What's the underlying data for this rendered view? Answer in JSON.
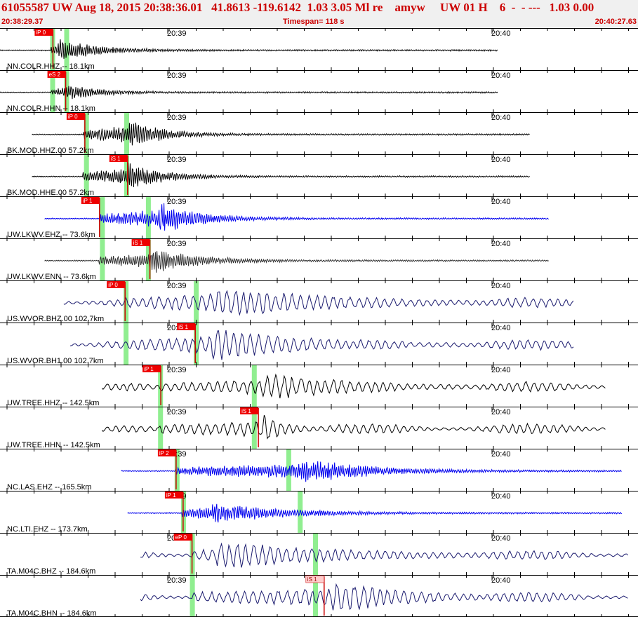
{
  "header": {
    "title": "61055587 UW Aug 18, 2015 20:38:36.01   41.8613 -119.6142  1.03 3.05 Ml re    amyw     UW 01 H    6  -  - ---   1.03 0.00",
    "time_start": "20:38:29.37",
    "timespan": "Timespan= 118 s",
    "time_end": "20:40:27.63"
  },
  "time_ticks": [
    "20:39",
    "20:40"
  ],
  "colors": {
    "trace_black": "#000000",
    "trace_blue": "#0000ee",
    "trace_gray": "#333333",
    "trace_navy": "#1a1a6e",
    "pick_flag": "#ee0000",
    "pick_flag_light": "#ffcccc",
    "phase_window": "#90ee90",
    "header_text": "#cc0000"
  },
  "channels": [
    {
      "label": "NN.COLR.HHZ -- 18.1km",
      "color": "trace_black",
      "start": 0.0,
      "end": 0.78,
      "onset": 0.08,
      "strong": 0.09,
      "amp": 0.55,
      "decay": 0.06,
      "freq": 1.0,
      "pick": "iP 0",
      "pick_pos": 0.083,
      "windows": [
        0.082,
        0.104
      ]
    },
    {
      "label": "NN.COLR.HHN -- 18.1km",
      "color": "trace_black",
      "start": 0.0,
      "end": 0.78,
      "onset": 0.08,
      "strong": 0.103,
      "amp": 0.4,
      "decay": 0.05,
      "freq": 1.0,
      "pick": "eS 2",
      "pick_pos": 0.103,
      "windows": [
        0.082,
        0.104
      ]
    },
    {
      "label": "BK.MOD.HHZ.00 57.2km",
      "color": "trace_black",
      "start": 0.05,
      "end": 0.83,
      "onset": 0.13,
      "strong": 0.2,
      "amp": 0.75,
      "decay": 0.05,
      "freq": 1.0,
      "pick": "iP 0",
      "pick_pos": 0.133,
      "windows": [
        0.135,
        0.198
      ]
    },
    {
      "label": "BK.MOD.HHE.00 57.2km",
      "color": "trace_black",
      "start": 0.05,
      "end": 0.83,
      "onset": 0.13,
      "strong": 0.2,
      "amp": 0.75,
      "decay": 0.05,
      "freq": 1.0,
      "pick": "iS 1",
      "pick_pos": 0.2,
      "windows": [
        0.135,
        0.198
      ]
    },
    {
      "label": "UW.LKWV.EHZ -- 73.6km",
      "color": "trace_blue",
      "start": 0.07,
      "end": 0.86,
      "onset": 0.155,
      "strong": 0.25,
      "amp": 0.8,
      "decay": 0.06,
      "freq": 1.0,
      "pick": "iP 1",
      "pick_pos": 0.156,
      "windows": [
        0.16,
        0.232
      ]
    },
    {
      "label": "UW.LKWV.ENN -- 73.6km",
      "color": "trace_gray",
      "start": 0.07,
      "end": 0.86,
      "onset": 0.155,
      "strong": 0.235,
      "amp": 0.65,
      "decay": 0.07,
      "freq": 1.0,
      "pick": "iS 1",
      "pick_pos": 0.235,
      "windows": [
        0.16,
        0.232
      ]
    },
    {
      "label": "US.WVOR.BHZ.00 102.7km",
      "color": "trace_navy",
      "start": 0.1,
      "end": 0.9,
      "onset": 0.195,
      "strong": 0.34,
      "amp": 0.8,
      "decay": 0.18,
      "freq": 0.45,
      "pick": "iP 0",
      "pick_pos": 0.196,
      "windows": [
        0.197,
        0.307
      ]
    },
    {
      "label": "US.WVOR.BH1.00 102.7km",
      "color": "trace_navy",
      "start": 0.11,
      "end": 0.9,
      "onset": 0.2,
      "strong": 0.33,
      "amp": 0.8,
      "decay": 0.16,
      "freq": 0.45,
      "pick": "iS 1",
      "pick_pos": 0.306,
      "windows": [
        0.197,
        0.307
      ]
    },
    {
      "label": "UW.TREE.HHZ -- 142.5km",
      "color": "trace_black",
      "start": 0.16,
      "end": 0.95,
      "onset": 0.25,
      "strong": 0.41,
      "amp": 0.65,
      "decay": 0.15,
      "freq": 0.55,
      "pick": "iP 1",
      "pick_pos": 0.252,
      "windows": [
        0.251,
        0.398
      ]
    },
    {
      "label": "UW.TREE.HHN -- 142.5km",
      "color": "trace_black",
      "start": 0.16,
      "end": 0.95,
      "onset": 0.25,
      "strong": 0.41,
      "amp": 0.7,
      "decay": 0.04,
      "freq": 0.55,
      "pick": "iS 1",
      "pick_pos": 0.405,
      "windows": [
        0.251,
        0.398
      ]
    },
    {
      "label": "NC.LAS.EHZ -- 165.5km",
      "color": "trace_blue",
      "start": 0.19,
      "end": 0.975,
      "onset": 0.275,
      "strong": 0.47,
      "amp": 0.65,
      "decay": 0.1,
      "freq": 1.0,
      "pick": "iP 2",
      "pick_pos": 0.276,
      "windows": [
        0.277,
        0.452
      ]
    },
    {
      "label": "NC.LTI.EHZ -- 173.7km",
      "color": "trace_blue",
      "start": 0.2,
      "end": 0.975,
      "onset": 0.285,
      "strong": 0.33,
      "amp": 0.55,
      "decay": 0.1,
      "freq": 1.0,
      "pick": "iP 1",
      "pick_pos": 0.287,
      "windows": [
        0.287,
        0.47
      ]
    },
    {
      "label": "TA.M04C.BHZ -- 184.6km",
      "color": "trace_navy",
      "start": 0.22,
      "end": 0.985,
      "onset": 0.3,
      "strong": 0.34,
      "amp": 0.7,
      "decay": 0.2,
      "freq": 0.45,
      "pick": "eP 0",
      "pick_pos": 0.301,
      "windows": [
        0.301,
        0.494
      ]
    },
    {
      "label": "TA.M04C.BHN -- 184.6km",
      "color": "trace_navy",
      "start": 0.22,
      "end": 0.985,
      "onset": 0.3,
      "strong": 0.52,
      "amp": 0.8,
      "decay": 0.12,
      "freq": 0.45,
      "pick": "iS 1",
      "pick_pos": 0.508,
      "pick_light": true,
      "windows": [
        0.301,
        0.494
      ]
    }
  ]
}
